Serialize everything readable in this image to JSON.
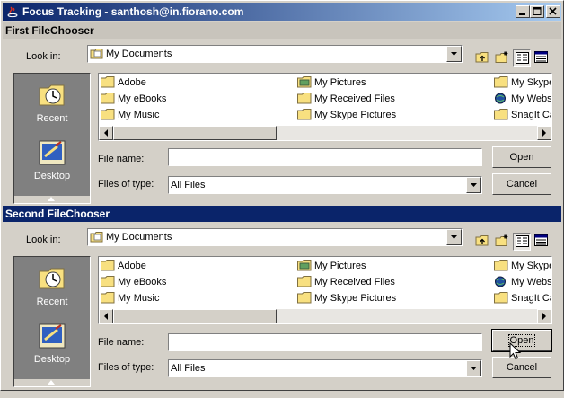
{
  "window": {
    "title": "Focus Tracking - santhosh@in.fiorano.com",
    "controls": [
      "minimize",
      "maximize",
      "close"
    ]
  },
  "choosers": [
    {
      "header": "First FileChooser",
      "header_active": false,
      "look_in_label": "Look in:",
      "look_in_value": "My Documents",
      "toolbar": [
        "up-folder",
        "new-folder",
        "list-view",
        "details-view"
      ],
      "places": [
        {
          "label": "Recent",
          "icon": "recent-icon"
        },
        {
          "label": "Desktop",
          "icon": "desktop-icon"
        }
      ],
      "files": [
        {
          "name": "Adobe",
          "icon": "folder"
        },
        {
          "name": "My eBooks",
          "icon": "folder"
        },
        {
          "name": "My Music",
          "icon": "folder"
        },
        {
          "name": "My Pictures",
          "icon": "pictures-folder"
        },
        {
          "name": "My Received Files",
          "icon": "folder"
        },
        {
          "name": "My Skype Pictures",
          "icon": "folder"
        },
        {
          "name": "My Skype",
          "icon": "folder"
        },
        {
          "name": "My Webs",
          "icon": "web-folder"
        },
        {
          "name": "SnagIt Ca",
          "icon": "folder"
        }
      ],
      "file_name_label": "File name:",
      "file_name_value": "",
      "files_of_type_label": "Files of type:",
      "files_of_type_value": "All Files",
      "open_label": "Open",
      "cancel_label": "Cancel",
      "open_focused": false
    },
    {
      "header": "Second FileChooser",
      "header_active": true,
      "look_in_label": "Look in:",
      "look_in_value": "My Documents",
      "toolbar": [
        "up-folder",
        "new-folder",
        "list-view",
        "details-view"
      ],
      "places": [
        {
          "label": "Recent",
          "icon": "recent-icon"
        },
        {
          "label": "Desktop",
          "icon": "desktop-icon"
        }
      ],
      "files": [
        {
          "name": "Adobe",
          "icon": "folder"
        },
        {
          "name": "My eBooks",
          "icon": "folder"
        },
        {
          "name": "My Music",
          "icon": "folder"
        },
        {
          "name": "My Pictures",
          "icon": "pictures-folder"
        },
        {
          "name": "My Received Files",
          "icon": "folder"
        },
        {
          "name": "My Skype Pictures",
          "icon": "folder"
        },
        {
          "name": "My Skype",
          "icon": "folder"
        },
        {
          "name": "My Webs",
          "icon": "web-folder"
        },
        {
          "name": "SnagIt Ca",
          "icon": "folder"
        }
      ],
      "file_name_label": "File name:",
      "file_name_value": "",
      "files_of_type_label": "Files of type:",
      "files_of_type_value": "All Files",
      "open_label": "Open",
      "cancel_label": "Cancel",
      "open_focused": true
    }
  ],
  "colors": {
    "titlebar_start": "#0a246a",
    "titlebar_end": "#a6caf0",
    "active_header": "#0a246a",
    "face": "#d4d0c8",
    "places_bg": "#808080",
    "folder": "#f8e080"
  }
}
